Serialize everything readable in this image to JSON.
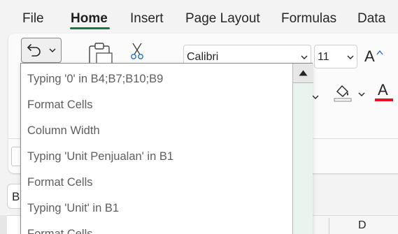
{
  "menu": {
    "tabs": [
      {
        "label": "File"
      },
      {
        "label": "Home"
      },
      {
        "label": "Insert"
      },
      {
        "label": "Page Layout"
      },
      {
        "label": "Formulas"
      },
      {
        "label": "Data"
      }
    ],
    "active_tab": "Home"
  },
  "ribbon": {
    "font_name": "Calibri",
    "font_size": "11",
    "grow_font_label": "A",
    "font_color_label": "A",
    "font_color_hex": "#e81123"
  },
  "undo_dropdown": {
    "items": [
      "Typing '0' in B4;B7;B10;B9",
      "Format Cells",
      "Column Width",
      "Typing 'Unit Penjualan' in B1",
      "Format Cells",
      "Typing 'Unit' in B1",
      "Format Cells"
    ]
  },
  "formula_bar": {
    "name_box_value": "B"
  },
  "grid": {
    "column_header": "D"
  },
  "colors": {
    "accent": "#107c41",
    "scrollbar_track": "#eaf4ee"
  }
}
